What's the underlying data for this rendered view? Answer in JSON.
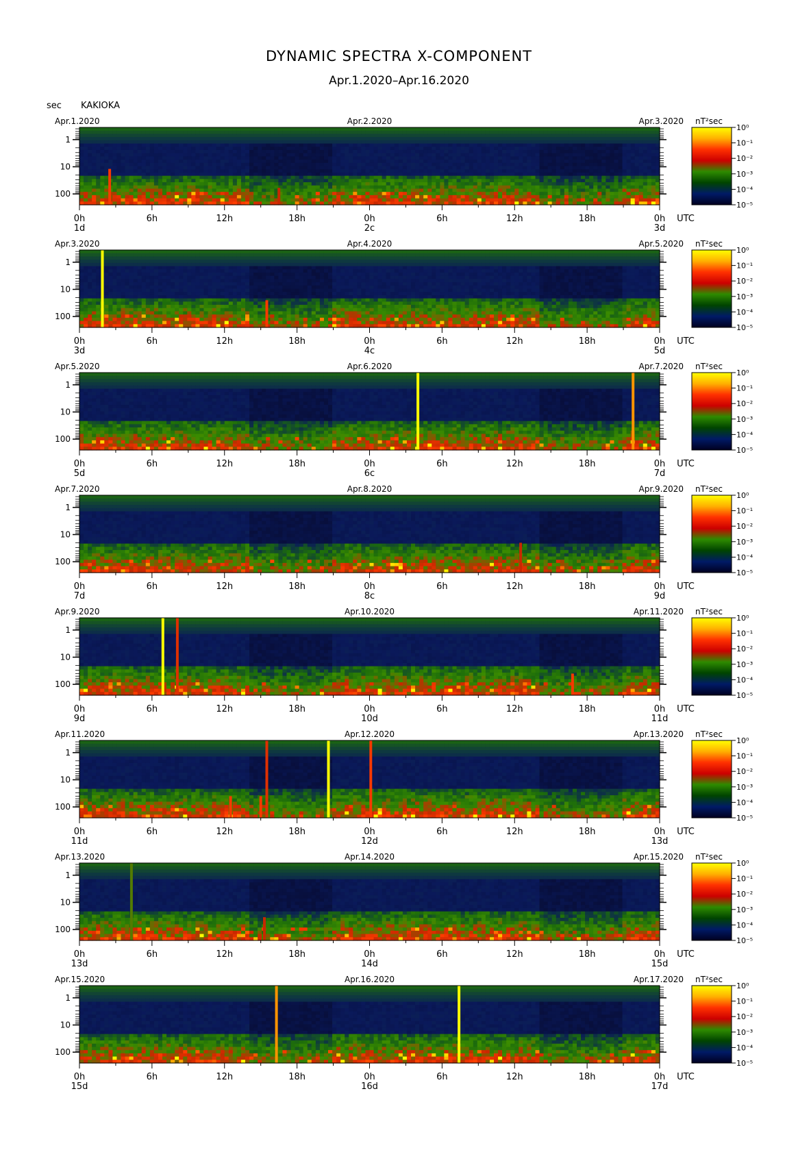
{
  "header": {
    "title": "DYNAMIC SPECTRA X-COMPONENT",
    "subtitle": "Apr.1.2020–Apr.16.2020",
    "ylabel": "sec",
    "station": "KAKIOKA"
  },
  "chart_data": {
    "type": "heatmap",
    "title": "DYNAMIC SPECTRA X-COMPONENT",
    "subtitle": "Apr.1.2020–Apr.16.2020",
    "station": "KAKIOKA",
    "ylabel": "sec",
    "y_scale": "log",
    "y_ticks": [
      "1",
      "10",
      "100"
    ],
    "x_ticks": [
      "0h",
      "6h",
      "12h",
      "18h",
      "0h",
      "6h",
      "12h",
      "18h",
      "0h"
    ],
    "x_unit": "UTC",
    "colorbar": {
      "label": "nT²sec",
      "ticks": [
        "10⁰",
        "10⁻¹",
        "10⁻²",
        "10⁻³",
        "10⁻⁴",
        "10⁻⁵"
      ],
      "colors": [
        "#ffff00",
        "#ffb000",
        "#ff3000",
        "#cc0000",
        "#2e8b00",
        "#004400",
        "#001a66",
        "#000020"
      ]
    },
    "panels": [
      {
        "start": "Apr.1.2020",
        "mid": "Apr.2.2020",
        "end": "Apr.3.2020",
        "day_labels": [
          "1d",
          "2c",
          "3d"
        ],
        "spikes": [
          {
            "hour": 2.5,
            "top_period": 12,
            "level": 0.8
          },
          {
            "hour": 16.5,
            "top_period": 60,
            "level": 0.7
          }
        ]
      },
      {
        "start": "Apr.3.2020",
        "mid": "Apr.4.2020",
        "end": "Apr.5.2020",
        "day_labels": [
          "3d",
          "4c",
          "5d"
        ],
        "spikes": [
          {
            "hour": 1.9,
            "top_period": 0.25,
            "level": 1.0
          },
          {
            "hour": 15.5,
            "top_period": 25,
            "level": 0.8
          }
        ]
      },
      {
        "start": "Apr.5.2020",
        "mid": "Apr.6.2020",
        "end": "Apr.7.2020",
        "day_labels": [
          "5d",
          "6c",
          "7d"
        ],
        "spikes": [
          {
            "hour": 28.0,
            "top_period": 0.25,
            "level": 1.0
          },
          {
            "hour": 45.8,
            "top_period": 0.25,
            "level": 0.9
          }
        ]
      },
      {
        "start": "Apr.7.2020",
        "mid": "Apr.8.2020",
        "end": "Apr.9.2020",
        "day_labels": [
          "7d",
          "8c",
          "9d"
        ],
        "spikes": [
          {
            "hour": 36.5,
            "top_period": 20,
            "level": 0.7
          }
        ]
      },
      {
        "start": "Apr.9.2020",
        "mid": "Apr.10.2020",
        "end": "Apr.11.2020",
        "day_labels": [
          "9d",
          "10d",
          "11d"
        ],
        "spikes": [
          {
            "hour": 6.9,
            "top_period": 0.25,
            "level": 1.0
          },
          {
            "hour": 8.1,
            "top_period": 0.25,
            "level": 0.75
          },
          {
            "hour": 40.8,
            "top_period": 40,
            "level": 0.8
          }
        ]
      },
      {
        "start": "Apr.11.2020",
        "mid": "Apr.12.2020",
        "end": "Apr.13.2020",
        "day_labels": [
          "11d",
          "12d",
          "13d"
        ],
        "spikes": [
          {
            "hour": 15.5,
            "top_period": 0.25,
            "level": 0.75
          },
          {
            "hour": 20.6,
            "top_period": 0.25,
            "level": 1.0
          },
          {
            "hour": 24.1,
            "top_period": 0.25,
            "level": 0.8
          },
          {
            "hour": 12.5,
            "top_period": 40,
            "level": 0.8
          },
          {
            "hour": 15.0,
            "top_period": 40,
            "level": 0.8
          }
        ]
      },
      {
        "start": "Apr.13.2020",
        "mid": "Apr.14.2020",
        "end": "Apr.15.2020",
        "day_labels": [
          "13d",
          "14d",
          "15d"
        ],
        "spikes": [
          {
            "hour": 4.3,
            "top_period": 0.25,
            "level": 0.6
          },
          {
            "hour": 15.3,
            "top_period": 35,
            "level": 0.7
          }
        ]
      },
      {
        "start": "Apr.15.2020",
        "mid": "Apr.16.2020",
        "end": "Apr.17.2020",
        "day_labels": [
          "15d",
          "16d",
          "17d"
        ],
        "spikes": [
          {
            "hour": 16.3,
            "top_period": 0.25,
            "level": 0.9
          },
          {
            "hour": 31.4,
            "top_period": 0.25,
            "level": 1.0
          }
        ]
      }
    ]
  }
}
